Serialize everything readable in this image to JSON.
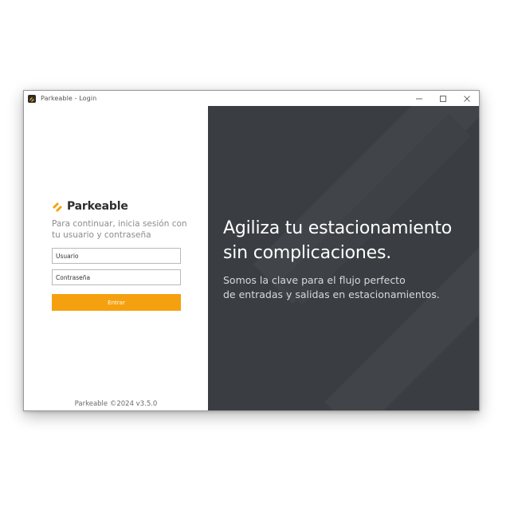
{
  "window": {
    "title": "Parkeable - Login",
    "controls": {
      "minimize_icon": "minimize-icon",
      "maximize_icon": "maximize-icon",
      "close_icon": "close-icon"
    }
  },
  "login": {
    "brand_name": "Parkeable",
    "subtitle": "Para continuar, inicia sesión con tu usuario y contraseña",
    "username": {
      "placeholder": "Usuario",
      "value": ""
    },
    "password": {
      "placeholder": "Contraseña",
      "value": ""
    },
    "submit_label": "Entrar",
    "footer": "Parkeable ©2024 v3.5.0"
  },
  "hero": {
    "headline_line1": "Agiliza tu estacionamiento",
    "headline_line2": "sin complicaciones.",
    "tagline_line1": "Somos la clave para el flujo perfecto",
    "tagline_line2": "de entradas y salidas en estacionamientos."
  },
  "colors": {
    "accent": "#f5a10f",
    "hero_background": "#3a3d41",
    "brand_text": "#2e2e2e",
    "muted_text": "#8c8c8c"
  }
}
